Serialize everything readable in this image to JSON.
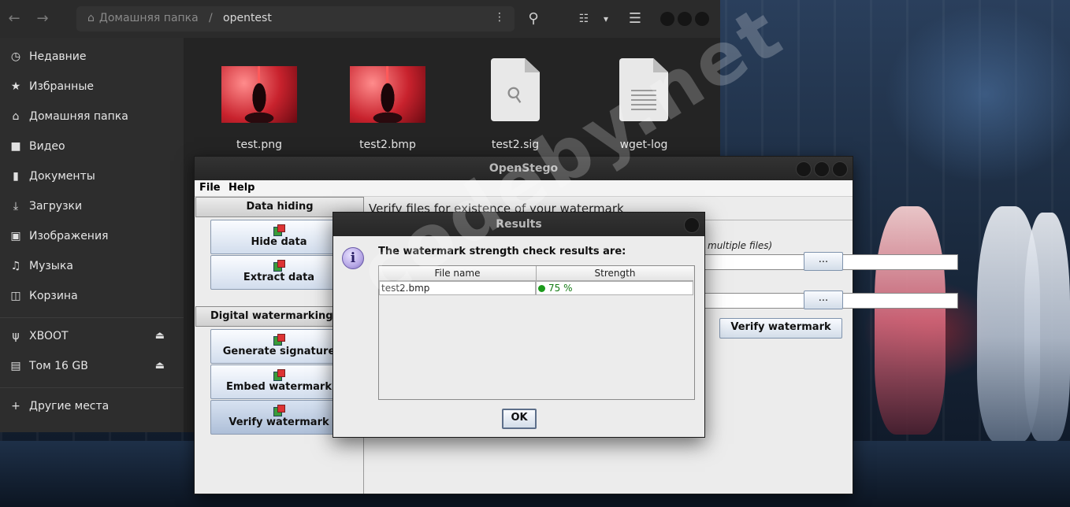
{
  "file_manager": {
    "path": {
      "home": "Домашняя папка",
      "separator": "/",
      "current": "opentest"
    },
    "sidebar": {
      "places": [
        {
          "label": "Недавние",
          "icon": "clock-icon"
        },
        {
          "label": "Избранные",
          "icon": "star-icon"
        },
        {
          "label": "Домашняя папка",
          "icon": "home-icon"
        },
        {
          "label": "Видео",
          "icon": "video-icon"
        },
        {
          "label": "Документы",
          "icon": "document-icon"
        },
        {
          "label": "Загрузки",
          "icon": "download-icon"
        },
        {
          "label": "Изображения",
          "icon": "image-icon"
        },
        {
          "label": "Музыка",
          "icon": "music-icon"
        },
        {
          "label": "Корзина",
          "icon": "trash-icon"
        }
      ],
      "devices": [
        {
          "label": "XBOOT",
          "icon": "usb-icon"
        },
        {
          "label": "Том 16 GB",
          "icon": "drive-icon"
        }
      ],
      "other": {
        "label": "Другие места",
        "icon": "plus-icon"
      }
    },
    "files": [
      {
        "name": "test.png",
        "kind": "image"
      },
      {
        "name": "test2.bmp",
        "kind": "image"
      },
      {
        "name": "test2.sig",
        "kind": "key"
      },
      {
        "name": "wget-log",
        "kind": "text"
      }
    ]
  },
  "openstego": {
    "title": "OpenStego",
    "menu": {
      "file": "File",
      "help": "Help"
    },
    "data_hiding": {
      "header": "Data hiding",
      "buttons": [
        "Hide data",
        "Extract data"
      ]
    },
    "watermarking": {
      "header": "Digital watermarking (B",
      "buttons": [
        "Generate signature",
        "Embed watermark",
        "Verify watermark"
      ]
    },
    "panel_title": "Verify files for existence of your watermark",
    "multi_hint": "multiple files)",
    "browse_label": "...",
    "verify_button": "Verify watermark"
  },
  "results_dialog": {
    "title": "Results",
    "message": "The watermark strength check results are:",
    "columns": [
      "File name",
      "Strength"
    ],
    "rows": [
      {
        "file": "test2.bmp",
        "strength": "75 %"
      }
    ],
    "ok": "OK"
  },
  "overlay_watermark": "codeby.net",
  "colors": {
    "strength_indicator": "#1b9a1b"
  }
}
